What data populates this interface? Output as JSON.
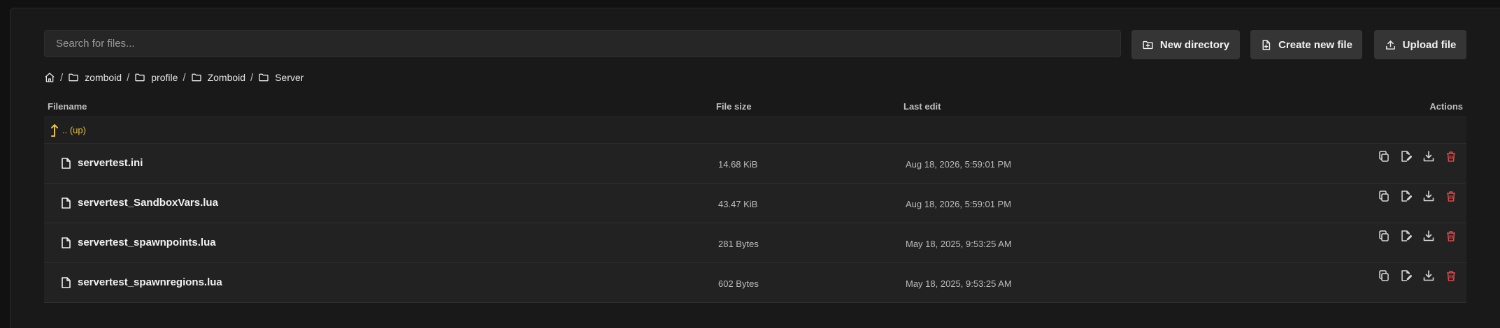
{
  "search": {
    "placeholder": "Search for files..."
  },
  "toolbar": {
    "new_directory_label": "New directory",
    "create_file_label": "Create new file",
    "upload_label": "Upload file"
  },
  "breadcrumb": {
    "items": [
      "zomboid",
      "profile",
      "Zomboid",
      "Server"
    ],
    "separator": "/"
  },
  "table": {
    "headers": {
      "filename": "Filename",
      "size": "File size",
      "edit": "Last edit",
      "actions": "Actions"
    },
    "up_label": ".. (up)",
    "rows": [
      {
        "name": "servertest.ini",
        "size": "14.68 KiB",
        "edit": "Aug 18, 2026, 5:59:01 PM"
      },
      {
        "name": "servertest_SandboxVars.lua",
        "size": "43.47 KiB",
        "edit": "Aug 18, 2026, 5:59:01 PM"
      },
      {
        "name": "servertest_spawnpoints.lua",
        "size": "281 Bytes",
        "edit": "May 18, 2025, 9:53:25 AM"
      },
      {
        "name": "servertest_spawnregions.lua",
        "size": "602 Bytes",
        "edit": "May 18, 2025, 9:53:25 AM"
      }
    ]
  },
  "colors": {
    "background": "#111111",
    "panel": "#191919",
    "button": "#353535",
    "up_link": "#e4c046",
    "delete": "#e04848"
  },
  "icons": [
    "home-icon",
    "folder-icon",
    "file-icon",
    "folder-plus-icon",
    "file-plus-icon",
    "upload-icon",
    "level-up-icon",
    "copy-icon",
    "rename-icon",
    "download-icon",
    "trash-icon"
  ]
}
